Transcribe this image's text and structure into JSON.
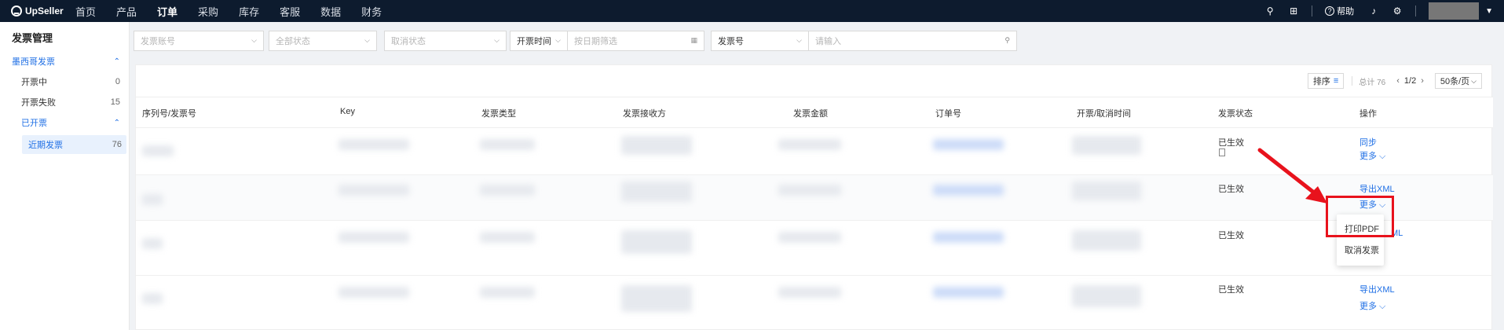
{
  "app": {
    "brand": "UpSeller",
    "avatar_label": ""
  },
  "nav": [
    {
      "label": "首页",
      "active": false
    },
    {
      "label": "产品",
      "active": false
    },
    {
      "label": "订单",
      "active": true
    },
    {
      "label": "采购",
      "active": false
    },
    {
      "label": "库存",
      "active": false
    },
    {
      "label": "客服",
      "active": false
    },
    {
      "label": "数据",
      "active": false
    },
    {
      "label": "财务",
      "active": false
    }
  ],
  "topright": {
    "help_label": "帮助"
  },
  "sidebar": {
    "title": "发票管理",
    "groups": [
      {
        "label": "墨西哥发票",
        "type": "group"
      },
      {
        "label": "开票中",
        "count": "0"
      },
      {
        "label": "开票失败",
        "count": "15"
      },
      {
        "label": "已开票",
        "type": "group"
      },
      {
        "label": "近期发票",
        "count": "76",
        "active": true
      }
    ]
  },
  "filters": {
    "invoice_no_placeholder": "发票账号",
    "all_status": "全部状态",
    "cancel_status": "取消状态",
    "time_type": "开票时间",
    "date_placeholder": "按日期筛选",
    "search_field": "发票号",
    "search_placeholder": "请输入"
  },
  "pager": {
    "sort_label": "排序",
    "total": "总计 76",
    "page": "1/2",
    "page_size": "50条/页"
  },
  "columns": [
    "序列号/发票号",
    "Key",
    "发票类型",
    "发票接收方",
    "发票金额",
    "订单号",
    "开票/取消时间",
    "发票状态",
    "操作"
  ],
  "rows": [
    {
      "status": "已生效",
      "actions": [
        "同步",
        "更多"
      ]
    },
    {
      "status": "已生效",
      "actions": [
        "导出XML",
        "更多"
      ]
    },
    {
      "status": "已生效",
      "actions": [
        "ML"
      ]
    },
    {
      "status": "已生效",
      "actions": [
        "导出XML",
        "更多"
      ]
    }
  ],
  "dropdown": {
    "items": [
      "打印PDF",
      "取消发票"
    ]
  },
  "colors": {
    "topbar": "#0d1b2e",
    "link": "#1f6fe5",
    "highlight": "#e8121c"
  }
}
